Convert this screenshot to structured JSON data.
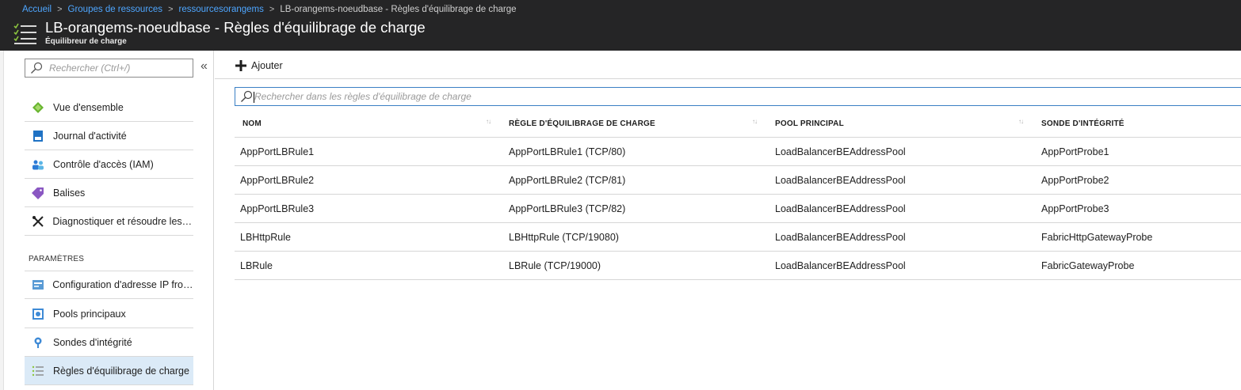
{
  "breadcrumb": {
    "items": [
      "Accueil",
      "Groupes de ressources",
      "ressourcesorangems"
    ],
    "current": "LB-orangems-noeudbase - Règles d'équilibrage de charge"
  },
  "header": {
    "title": "LB-orangems-noeudbase - Règles d'équilibrage de charge",
    "subtitle": "Équilibreur de charge"
  },
  "sidebar": {
    "search_placeholder": "Rechercher (Ctrl+/)",
    "collapse_glyph": "«",
    "items": [
      {
        "label": "Vue d'ensemble",
        "icon": "overview-icon"
      },
      {
        "label": "Journal d'activité",
        "icon": "activity-log-icon"
      },
      {
        "label": "Contrôle d'accès (IAM)",
        "icon": "iam-icon"
      },
      {
        "label": "Balises",
        "icon": "tag-icon"
      },
      {
        "label": "Diagnostiquer et résoudre les p...",
        "icon": "wrench-icon"
      }
    ],
    "section_label": "PARAMÈTRES",
    "settings_items": [
      {
        "label": "Configuration d'adresse IP front...",
        "icon": "frontend-ip-icon"
      },
      {
        "label": "Pools principaux",
        "icon": "backend-pool-icon"
      },
      {
        "label": "Sondes d'intégrité",
        "icon": "probe-icon"
      },
      {
        "label": "Règles d'équilibrage de charge",
        "icon": "rules-icon",
        "active": true
      }
    ]
  },
  "toolbar": {
    "add_label": "Ajouter"
  },
  "filter": {
    "placeholder": "Rechercher dans les règles d'équilibrage de charge"
  },
  "table": {
    "columns": [
      "NOM",
      "RÈGLE D'ÉQUILIBRAGE DE CHARGE",
      "POOL PRINCIPAL",
      "SONDE D'INTÉGRITÉ"
    ],
    "sort_glyph": "↑↓",
    "rows": [
      [
        "AppPortLBRule1",
        "AppPortLBRule1 (TCP/80)",
        "LoadBalancerBEAddressPool",
        "AppPortProbe1"
      ],
      [
        "AppPortLBRule2",
        "AppPortLBRule2 (TCP/81)",
        "LoadBalancerBEAddressPool",
        "AppPortProbe2"
      ],
      [
        "AppPortLBRule3",
        "AppPortLBRule3 (TCP/82)",
        "LoadBalancerBEAddressPool",
        "AppPortProbe3"
      ],
      [
        "LBHttpRule",
        "LBHttpRule (TCP/19080)",
        "LoadBalancerBEAddressPool",
        "FabricHttpGatewayProbe"
      ],
      [
        "LBRule",
        "LBRule (TCP/19000)",
        "LoadBalancerBEAddressPool",
        "FabricGatewayProbe"
      ]
    ]
  },
  "colors": {
    "header_bg": "#252526",
    "link": "#4ea6ff",
    "accent": "#3a7fc4",
    "active_nav_bg": "#dbeaf7"
  }
}
